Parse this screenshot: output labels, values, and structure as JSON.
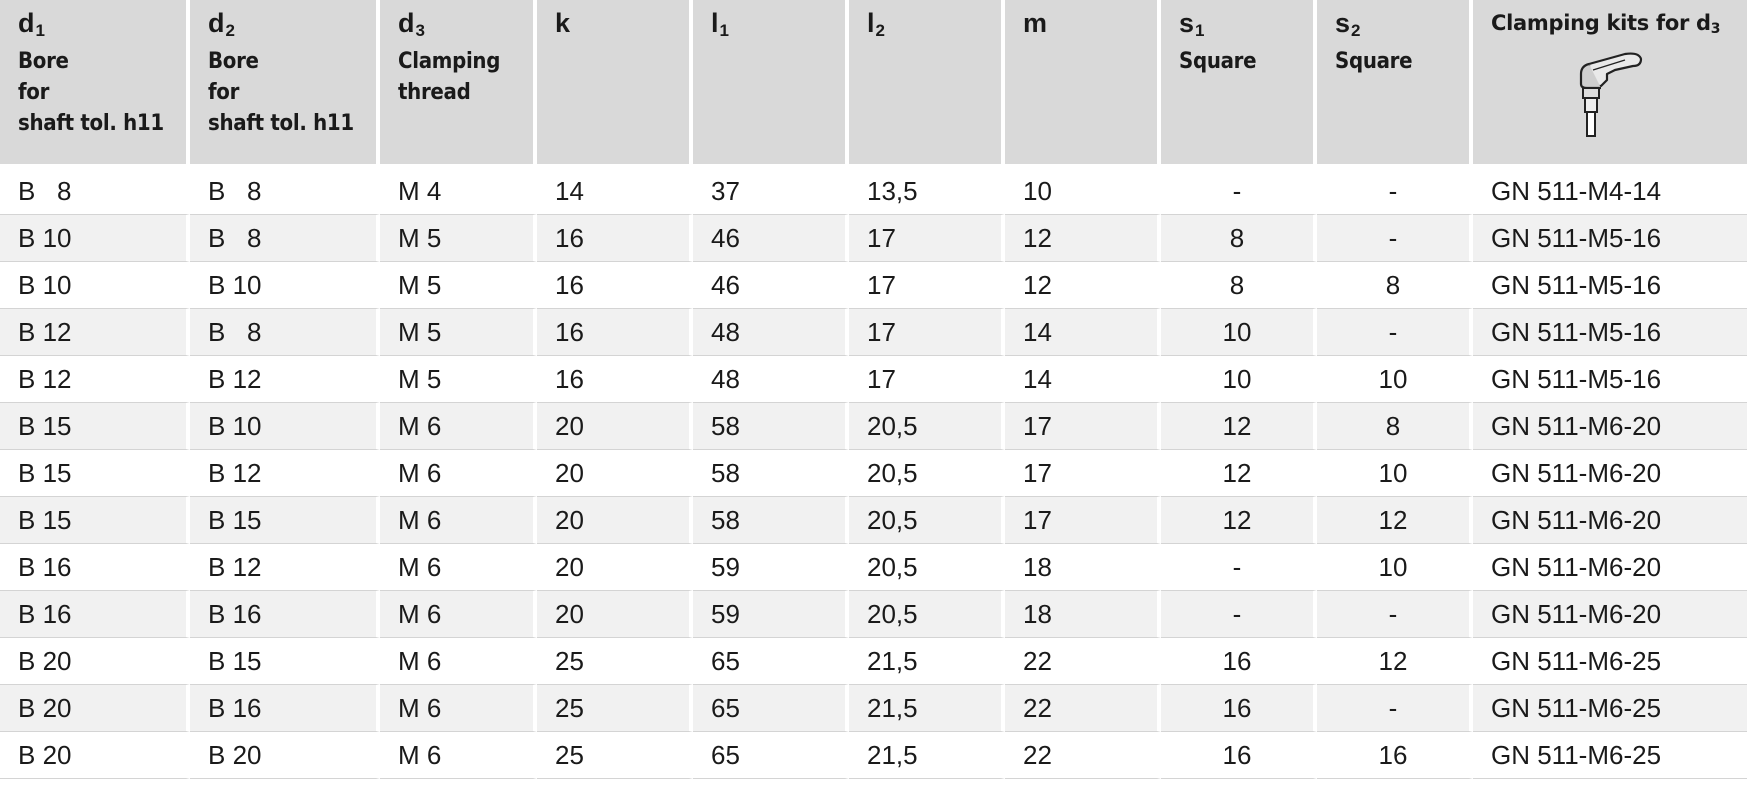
{
  "header": {
    "columns": [
      {
        "symbol": "d",
        "sub": "1",
        "desc": "Bore\nfor\nshaft tol. h11"
      },
      {
        "symbol": "d",
        "sub": "2",
        "desc": "Bore\nfor\nshaft tol. h11"
      },
      {
        "symbol": "d",
        "sub": "3",
        "desc": "Clamping\nthread"
      },
      {
        "symbol": "k",
        "sub": "",
        "desc": ""
      },
      {
        "symbol": "l",
        "sub": "1",
        "desc": ""
      },
      {
        "symbol": "l",
        "sub": "2",
        "desc": ""
      },
      {
        "symbol": "m",
        "sub": "",
        "desc": ""
      },
      {
        "symbol": "s",
        "sub": "1",
        "desc": "Square"
      },
      {
        "symbol": "s",
        "sub": "2",
        "desc": "Square"
      }
    ],
    "kit_title": "Clamping kits for d",
    "kit_title_sub": "3",
    "kit_icon": "clamping-lever-icon"
  },
  "rows": [
    [
      "B   8",
      "B   8",
      "M 4",
      "14",
      "37",
      "13,5",
      "10",
      "-",
      "-",
      "GN 511-M4-14"
    ],
    [
      "B 10",
      "B   8",
      "M 5",
      "16",
      "46",
      "17",
      "12",
      "8",
      "-",
      "GN 511-M5-16"
    ],
    [
      "B 10",
      "B 10",
      "M 5",
      "16",
      "46",
      "17",
      "12",
      "8",
      "8",
      "GN 511-M5-16"
    ],
    [
      "B 12",
      "B   8",
      "M 5",
      "16",
      "48",
      "17",
      "14",
      "10",
      "-",
      "GN 511-M5-16"
    ],
    [
      "B 12",
      "B 12",
      "M 5",
      "16",
      "48",
      "17",
      "14",
      "10",
      "10",
      "GN 511-M5-16"
    ],
    [
      "B 15",
      "B 10",
      "M 6",
      "20",
      "58",
      "20,5",
      "17",
      "12",
      "8",
      "GN 511-M6-20"
    ],
    [
      "B 15",
      "B 12",
      "M 6",
      "20",
      "58",
      "20,5",
      "17",
      "12",
      "10",
      "GN 511-M6-20"
    ],
    [
      "B 15",
      "B 15",
      "M 6",
      "20",
      "58",
      "20,5",
      "17",
      "12",
      "12",
      "GN 511-M6-20"
    ],
    [
      "B 16",
      "B 12",
      "M 6",
      "20",
      "59",
      "20,5",
      "18",
      "-",
      "10",
      "GN 511-M6-20"
    ],
    [
      "B 16",
      "B 16",
      "M 6",
      "20",
      "59",
      "20,5",
      "18",
      "-",
      "-",
      "GN 511-M6-20"
    ],
    [
      "B 20",
      "B 15",
      "M 6",
      "25",
      "65",
      "21,5",
      "22",
      "16",
      "12",
      "GN 511-M6-25"
    ],
    [
      "B 20",
      "B 16",
      "M 6",
      "25",
      "65",
      "21,5",
      "22",
      "16",
      "-",
      "GN 511-M6-25"
    ],
    [
      "B 20",
      "B 20",
      "M 6",
      "25",
      "65",
      "21,5",
      "22",
      "16",
      "16",
      "GN 511-M6-25"
    ]
  ]
}
